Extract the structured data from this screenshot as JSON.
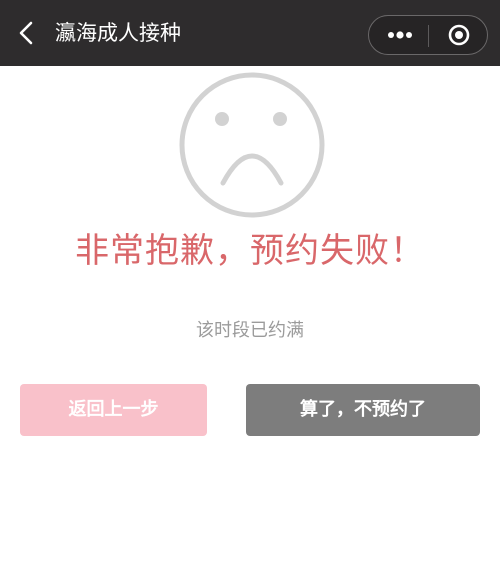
{
  "header": {
    "title": "瀛海成人接种",
    "back_icon": "chevron-left-icon",
    "more_icon": "more-dots-icon",
    "close_icon": "target-close-icon",
    "background_color": "#2e2c2d"
  },
  "status": {
    "icon": "sad-face-icon",
    "headline": "非常抱歉，预约失败！",
    "headline_color": "#d9676a",
    "message": "该时段已约满"
  },
  "actions": {
    "back_label": "返回上一步",
    "back_color": "#f9c1ca",
    "cancel_label": "算了，不预约了",
    "cancel_color": "#7d7d7d"
  }
}
